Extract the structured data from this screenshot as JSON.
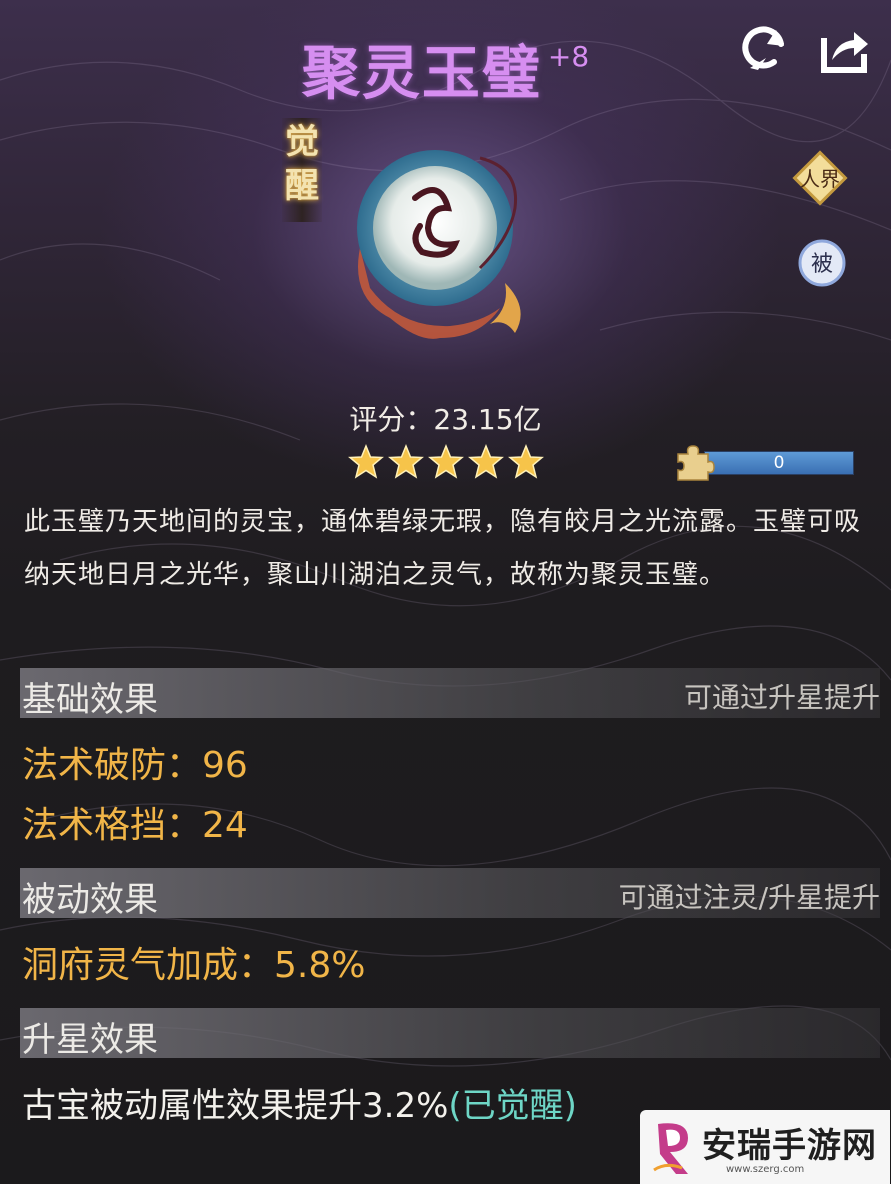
{
  "header": {
    "item_name": "聚灵玉璧",
    "level": "+8",
    "awaken_tag": "觉醒"
  },
  "badges": {
    "realm": "人界",
    "passive": "被"
  },
  "icons": {
    "back": "refresh-arrow-icon",
    "share": "share-icon",
    "puzzle": "puzzle-piece-icon",
    "star": "star-icon"
  },
  "rating": {
    "score_text": "评分：23.15亿",
    "stars": 5
  },
  "fragments": {
    "value": "0",
    "progress": 0
  },
  "description": "此玉璧乃天地间的灵宝，通体碧绿无瑕，隐有皎月之光流露。玉璧可吸纳天地日月之光华，聚山川湖泊之灵气，故称为聚灵玉璧。",
  "sections": {
    "basic": {
      "label": "基础效果",
      "hint": "可通过升星提升"
    },
    "passive": {
      "label": "被动效果",
      "hint": "可通过注灵/升星提升"
    },
    "star": {
      "label": "升星效果"
    }
  },
  "stats": {
    "basic": [
      "法术破防：96",
      "法术格挡：24"
    ],
    "passive": [
      "洞府灵气加成：5.8%"
    ]
  },
  "star_effect": {
    "text": "古宝被动属性效果提升3.2%",
    "status": "(已觉醒)"
  },
  "watermark": {
    "brand": "安瑞手游网",
    "url": "www.szerg.com"
  },
  "colors": {
    "title": "#d68ef0",
    "stat": "#f1b548",
    "awakened": "#6ed6c6"
  }
}
